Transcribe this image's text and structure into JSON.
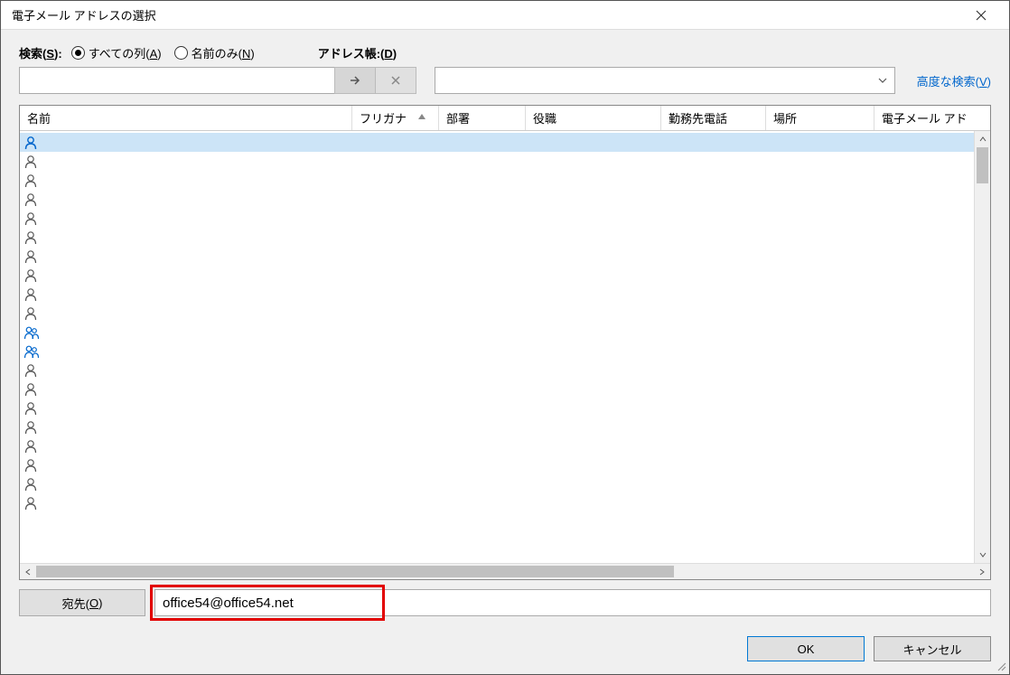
{
  "title": "電子メール アドレスの選択",
  "search": {
    "label_prefix": "検索(",
    "label_key": "S",
    "label_suffix": "):",
    "radio_all_prefix": "すべての列(",
    "radio_all_key": "A",
    "radio_all_suffix": ")",
    "radio_name_prefix": "名前のみ(",
    "radio_name_key": "N",
    "radio_name_suffix": ")",
    "value": ""
  },
  "address_book": {
    "label_prefix": "アドレス帳:(",
    "label_key": "D",
    "label_suffix": ")",
    "value": ""
  },
  "advanced": {
    "prefix": "高度な検索(",
    "key": "V",
    "suffix": ")"
  },
  "columns": {
    "name": "名前",
    "furigana": "フリガナ",
    "dept": "部署",
    "title": "役職",
    "phone": "勤務先電話",
    "location": "場所",
    "email": "電子メール アド"
  },
  "rows": [
    {
      "type": "person",
      "selected": true
    },
    {
      "type": "person"
    },
    {
      "type": "person"
    },
    {
      "type": "person"
    },
    {
      "type": "person"
    },
    {
      "type": "person"
    },
    {
      "type": "person"
    },
    {
      "type": "person"
    },
    {
      "type": "person"
    },
    {
      "type": "person"
    },
    {
      "type": "group"
    },
    {
      "type": "group"
    },
    {
      "type": "person"
    },
    {
      "type": "person"
    },
    {
      "type": "person"
    },
    {
      "type": "person"
    },
    {
      "type": "person"
    },
    {
      "type": "person"
    },
    {
      "type": "person"
    },
    {
      "type": "person"
    }
  ],
  "to": {
    "btn_prefix": "宛先(",
    "btn_key": "O",
    "btn_suffix": ")",
    "value": "office54@office54.net"
  },
  "footer": {
    "ok": "OK",
    "cancel": "キャンセル"
  }
}
